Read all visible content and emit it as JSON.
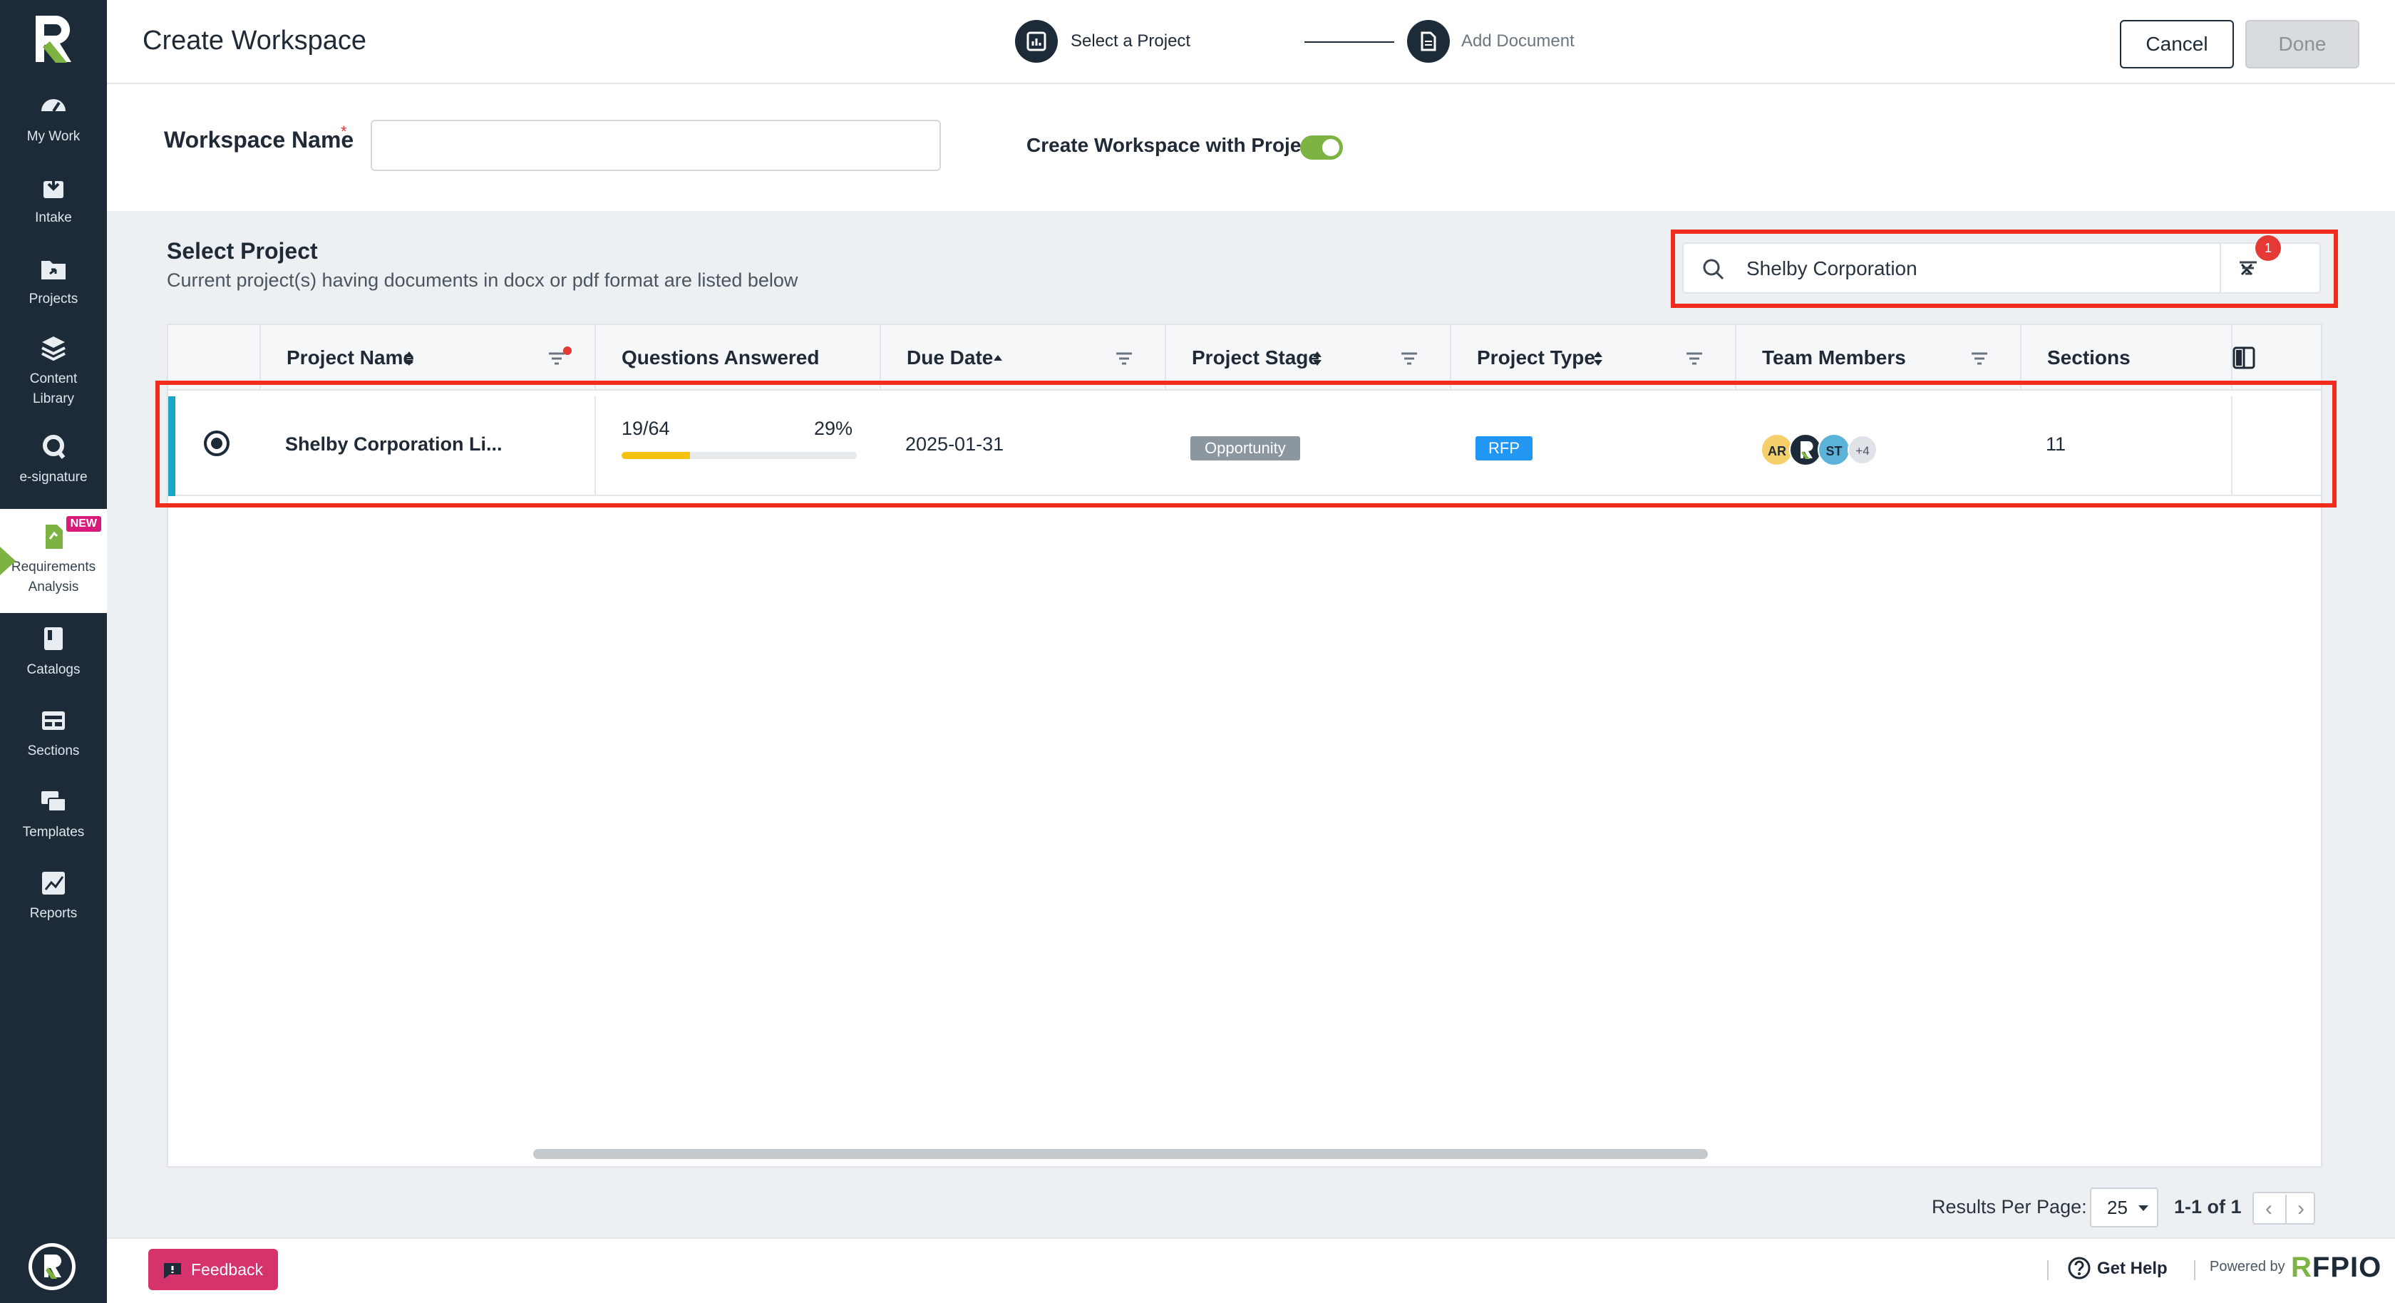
{
  "sidebar": {
    "items": [
      {
        "label": "My Work",
        "icon": "gauge-icon"
      },
      {
        "label": "Intake",
        "icon": "intake-icon"
      },
      {
        "label": "Projects",
        "icon": "projects-icon"
      },
      {
        "label": "Content Library",
        "icon": "layers-icon"
      },
      {
        "label": "e-signature",
        "icon": "signature-icon"
      },
      {
        "label": "Requirements Analysis",
        "icon": "requirements-icon",
        "badge": "NEW"
      },
      {
        "label": "Catalogs",
        "icon": "catalogs-icon"
      },
      {
        "label": "Sections",
        "icon": "sections-icon"
      },
      {
        "label": "Templates",
        "icon": "templates-icon"
      },
      {
        "label": "Reports",
        "icon": "reports-icon"
      }
    ]
  },
  "header": {
    "title": "Create Workspace",
    "steps": [
      {
        "label": "Select a Project"
      },
      {
        "label": "Add Document"
      }
    ],
    "cancel_label": "Cancel",
    "done_label": "Done"
  },
  "workspace": {
    "name_label": "Workspace Name",
    "required_mark": "*",
    "name_value": "",
    "toggle_label": "Create Workspace with Project",
    "toggle_on": true
  },
  "select_project": {
    "title": "Select Project",
    "subtitle": "Current project(s) having documents in docx or pdf format are listed below",
    "search_value": "Shelby Corporation",
    "filter_count": "1"
  },
  "table": {
    "columns": {
      "project_name": "Project Name",
      "questions_answered": "Questions Answered",
      "due_date": "Due Date",
      "project_stage": "Project Stage",
      "project_type": "Project Type",
      "team_members": "Team Members",
      "sections": "Sections"
    },
    "rows": [
      {
        "project_name": "Shelby Corporation Li...",
        "questions": "19/64",
        "percent": "29%",
        "progress": 0.29,
        "due_date": "2025-01-31",
        "stage": "Opportunity",
        "type": "RFP",
        "members": [
          "AR",
          "R",
          "ST"
        ],
        "members_more": "+4",
        "sections": "11"
      }
    ]
  },
  "pagination": {
    "label": "Results Per Page:",
    "per_page": "25",
    "range": "1-1 of 1"
  },
  "footer": {
    "feedback_label": "Feedback",
    "help_label": "Get Help",
    "powered_label": "Powered by",
    "brand": "RFPIO"
  },
  "colors": {
    "sidebar_bg": "#1d2b38",
    "accent_green": "#7cb342",
    "highlight_red": "#f02d1c",
    "progress_yellow": "#f4c20d",
    "type_blue": "#2196f3",
    "stage_grey": "#8c969f",
    "feedback_pink": "#d6336c"
  }
}
